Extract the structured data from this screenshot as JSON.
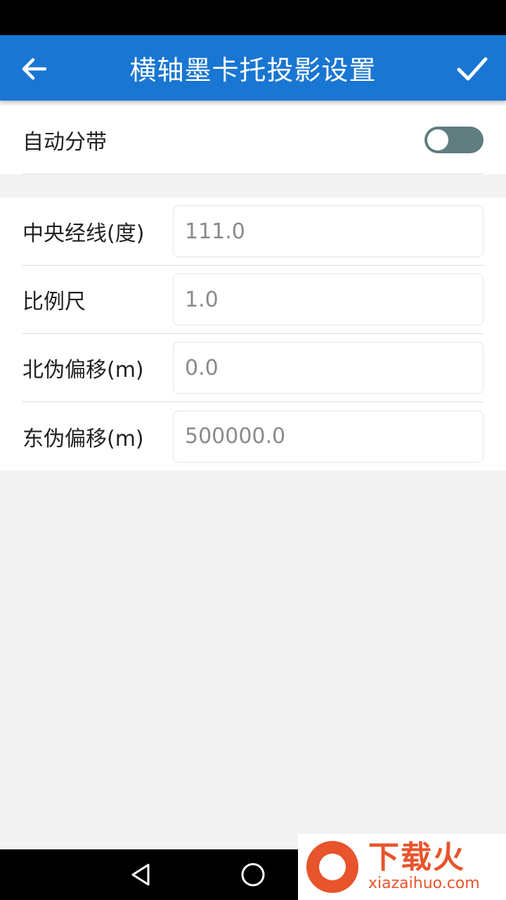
{
  "app_bar": {
    "title": "横轴墨卡托投影设置",
    "back_icon": "arrow-left-icon",
    "confirm_icon": "checkmark-icon",
    "color": "#1976d2"
  },
  "auto_zone": {
    "label": "自动分带",
    "enabled": false
  },
  "fields": [
    {
      "label": "中央经线(度)",
      "value": "111.0"
    },
    {
      "label": "比例尺",
      "value": "1.0"
    },
    {
      "label": "北伪偏移(m)",
      "value": "0.0"
    },
    {
      "label": "东伪偏移(m)",
      "value": "500000.0"
    }
  ],
  "nav": {
    "back_icon": "triangle-back-icon",
    "home_icon": "circle-home-icon"
  },
  "watermark": {
    "brand_cn": "下载火",
    "brand_en": "xiazaihuo.com"
  }
}
